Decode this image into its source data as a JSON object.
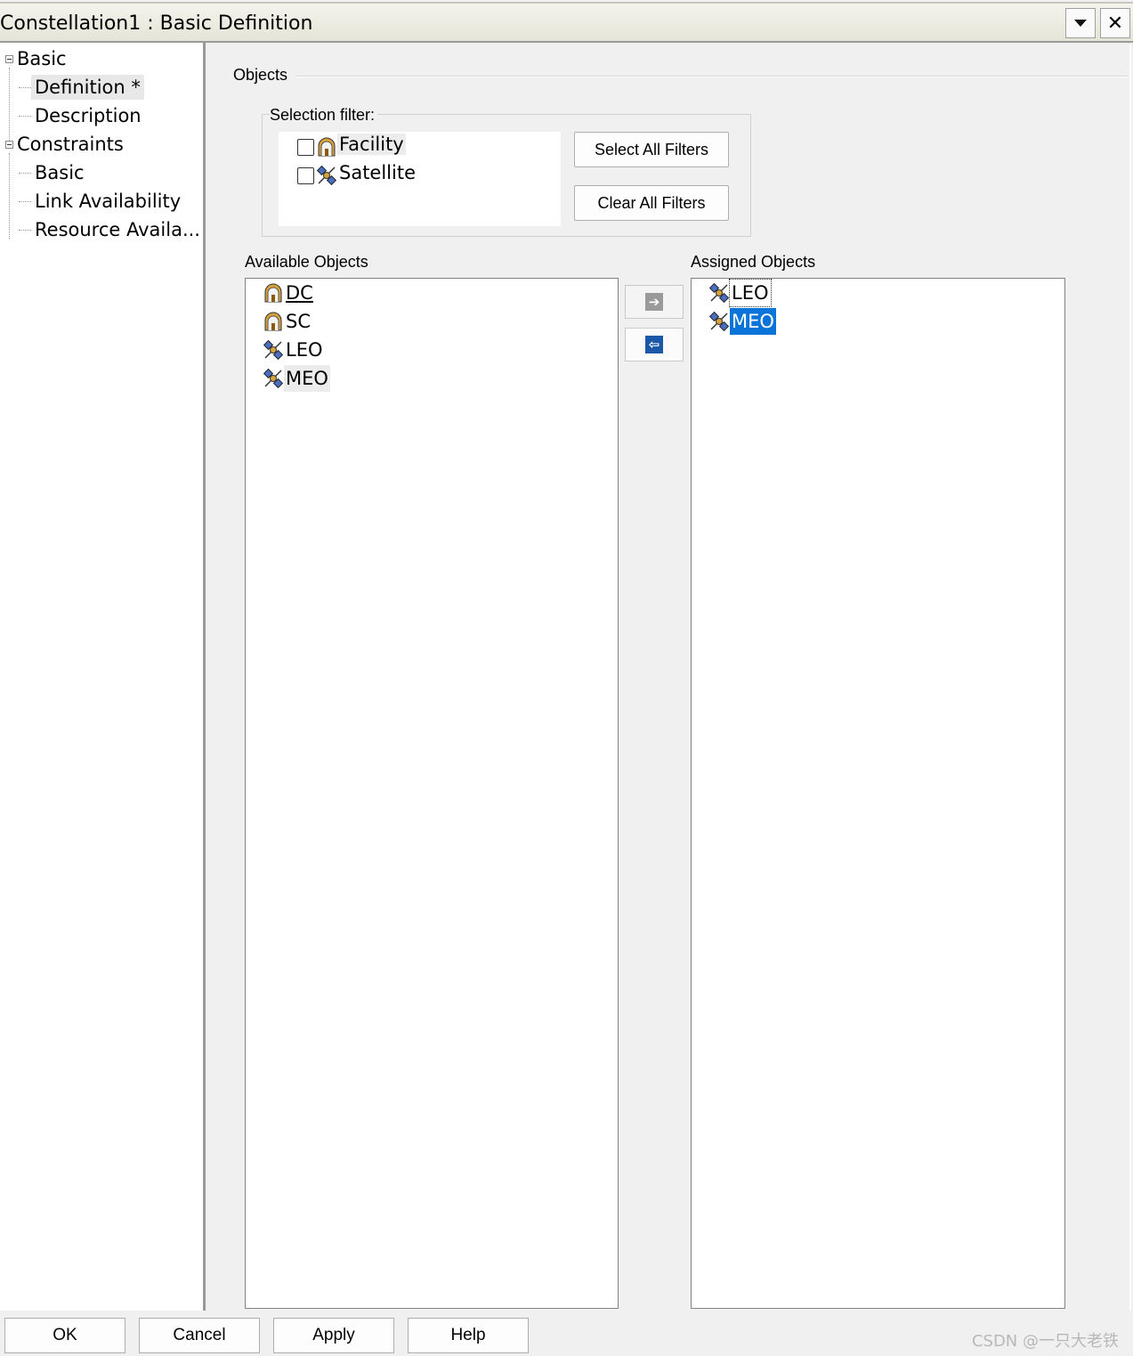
{
  "window": {
    "title": "Constellation1 : Basic Definition",
    "dropdown_icon": "triangle-down-icon",
    "close_icon": "close-icon",
    "close_glyph": "✕"
  },
  "tree": {
    "nodes": [
      {
        "label": "Basic",
        "level": 0,
        "expanded": true
      },
      {
        "label": "Definition *",
        "level": 1,
        "selected": true
      },
      {
        "label": "Description",
        "level": 1
      },
      {
        "label": "Constraints",
        "level": 0,
        "expanded": true
      },
      {
        "label": "Basic",
        "level": 1
      },
      {
        "label": "Link Availability",
        "level": 1
      },
      {
        "label": "Resource Availa...",
        "level": 1
      }
    ]
  },
  "objects_group": {
    "label": "Objects",
    "selection_filter": {
      "label": "Selection filter:",
      "items": [
        {
          "label": "Facility",
          "icon": "facility-icon",
          "checked": false
        },
        {
          "label": "Satellite",
          "icon": "satellite-icon",
          "checked": false
        }
      ],
      "select_all_label": "Select All Filters",
      "clear_all_label": "Clear All Filters"
    },
    "available": {
      "label": "Available Objects",
      "items": [
        {
          "label": "DC",
          "icon": "facility-icon"
        },
        {
          "label": "SC",
          "icon": "facility-icon"
        },
        {
          "label": "LEO",
          "icon": "satellite-icon"
        },
        {
          "label": "MEO",
          "icon": "satellite-icon"
        }
      ]
    },
    "assigned": {
      "label": "Assigned Objects",
      "items": [
        {
          "label": "LEO",
          "icon": "satellite-icon"
        },
        {
          "label": "MEO",
          "icon": "satellite-icon",
          "selected": true
        }
      ]
    },
    "move_right_icon": "arrow-right-icon",
    "move_left_icon": "arrow-left-icon",
    "move_right_glyph": "➔",
    "move_left_glyph": "⇦"
  },
  "buttons": {
    "ok": "OK",
    "cancel": "Cancel",
    "apply": "Apply",
    "help": "Help"
  },
  "watermark": "CSDN @一只大老铁",
  "colors": {
    "selection": "#0a74d8",
    "facility_icon": "#c98a1a",
    "satellite_icon": "#3b5fb0"
  }
}
